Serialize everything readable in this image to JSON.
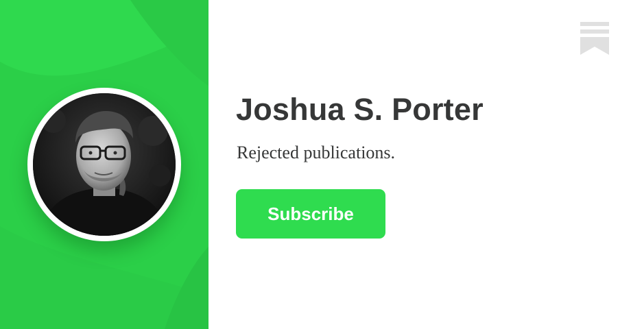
{
  "profile": {
    "name": "Joshua S. Porter",
    "tagline": "Rejected publications."
  },
  "subscribe": {
    "label": "Subscribe"
  },
  "icons": {
    "logo": "substack-bookmark-icon",
    "avatar": "profile-photo"
  },
  "colors": {
    "accent": "#2fd94e",
    "button": "#2fdc4f",
    "text": "#363737",
    "logo": "#e0e0e0"
  }
}
